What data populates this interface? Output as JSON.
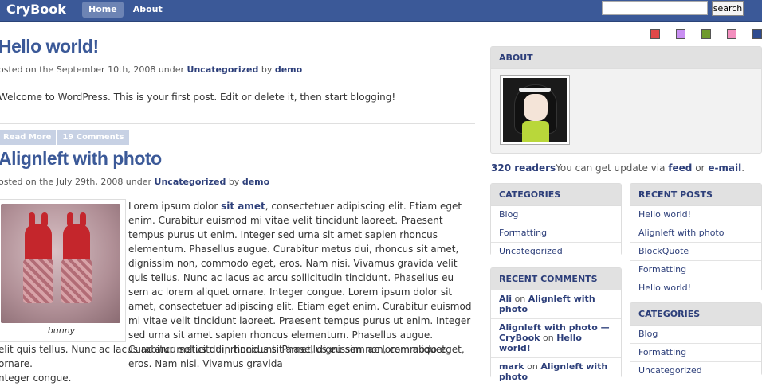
{
  "header": {
    "brand": "CryBook",
    "nav": [
      "Home",
      "About"
    ],
    "search_button": "search",
    "search_placeholder": ""
  },
  "swatches": [
    "#e04848",
    "#c98ff2",
    "#6f9a2c",
    "#f28fbe",
    "#2e4b8f"
  ],
  "posts": [
    {
      "title": "Hello world!",
      "meta_prefix": "osted on the September 10th, 2008 under",
      "category": "Uncategorized",
      "by": "by",
      "author": "demo",
      "body": "Welcome to WordPress. This is your first post. Edit or delete it, then start blogging!",
      "read_more": "Read More",
      "comments": "19 Comments"
    },
    {
      "title": "Alignleft with photo",
      "meta_prefix": "osted on the July 29th, 2008 under",
      "category": "Uncategorized",
      "by": "by",
      "author": "demo",
      "caption": "bunny",
      "text_a": "Lorem ipsum dolor",
      "text_link": "sit amet",
      "text_b": ", consectetuer adipiscing elit. Etiam eget enim. Curabitur euismod mi vitae velit tincidunt laoreet. Praesent tempus purus ut enim. Integer sed urna sit amet sapien rhoncus elementum. Phasellus augue. Curabitur metus dui, rhoncus sit amet, dignissim non, commodo eget, eros. Nam nisi. Vivamus gravida velit quis tellus. Nunc ac lacus ac arcu sollicitudin tincidunt. Phasellus eu sem ac lorem aliquet ornare. Integer congue. Lorem ipsum dolor sit amet, consectetuer adipiscing elit. Etiam eget enim. Curabitur euismod mi vitae velit tincidunt laoreet. Praesent tempus purus ut enim. Integer sed urna sit amet sapien rhoncus elementum. Phasellus augue. Curabitur metus dui, rhoncus sit amet, dignissim non, commodo eget, eros. Nam nisi. Vivamus gravida",
      "text_c": "elit quis tellus. Nunc ac lacus ac arcu sollicitudin tincidunt. Phasellus eu sem ac lorem aliquet ornare.",
      "text_d": "nteger congue."
    }
  ],
  "sidebar": {
    "about_title": "ABOUT",
    "readers_count": "320 readers",
    "readers_text": "You can get update via",
    "feed": "feed",
    "or": "or",
    "email": "e-mail",
    "period": ".",
    "categories_title": "CATEGORIES",
    "categories": [
      "Blog",
      "Formatting",
      "Uncategorized"
    ],
    "recent_posts_title": "RECENT POSTS",
    "recent_posts": [
      "Hello world!",
      "Alignleft with photo",
      "BlockQuote",
      "Formatting",
      "Hello world!"
    ],
    "recent_comments_title": "RECENT COMMENTS",
    "recent_comments": [
      {
        "author": "Ali",
        "on": "on",
        "post": "Alignleft with photo"
      },
      {
        "author": "Alignleft with photo — CryBook",
        "on": "on",
        "post": "Hello world!"
      },
      {
        "author": "mark",
        "on": "on",
        "post": "Alignleft with photo"
      }
    ],
    "categories2_title": "CATEGORIES",
    "categories2": [
      "Blog",
      "Formatting",
      "Uncategorized"
    ]
  }
}
